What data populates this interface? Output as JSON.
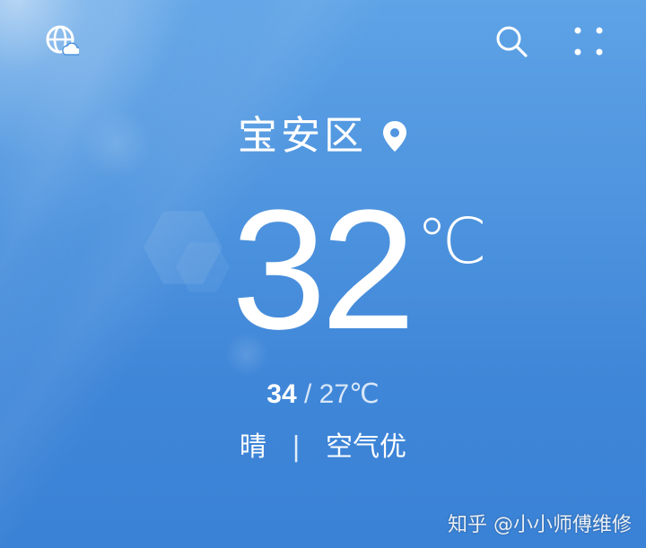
{
  "header": {
    "left_icon": "globe-cloud-icon",
    "search_icon": "search-icon",
    "menu_icon": "grid-dots-icon"
  },
  "location": {
    "name": "宝安区",
    "icon": "location-pin-icon"
  },
  "current": {
    "temperature": "32",
    "unit": "℃"
  },
  "range": {
    "high": "34",
    "separator": " / ",
    "low": "27℃"
  },
  "condition": {
    "weather": "晴",
    "divider": "|",
    "air_quality": "空气优"
  },
  "watermark": {
    "text": "知乎 @小小师傅维修"
  },
  "colors": {
    "background_top": "#5ea3e6",
    "background_bottom": "#3a82d6",
    "text": "#ffffff"
  }
}
